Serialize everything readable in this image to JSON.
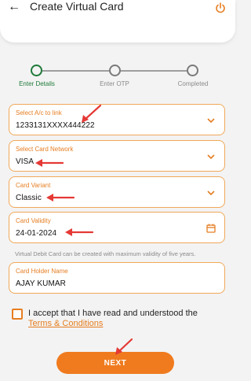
{
  "header": {
    "title": "Create Virtual Card",
    "back_icon": "arrow-left-icon",
    "power_icon": "power-icon",
    "power_color": "#e67e22"
  },
  "stepper": {
    "steps": [
      {
        "label": "Enter Details",
        "active": true
      },
      {
        "label": "Enter OTP",
        "active": false
      },
      {
        "label": "Completed",
        "active": false
      }
    ],
    "active_color": "#1f7a3a"
  },
  "form": {
    "account": {
      "label": "Select A/c to link",
      "value": "1233131XXXX444222",
      "icon": "chevron-down-icon"
    },
    "network": {
      "label": "Select Card Network",
      "value": "VISA",
      "icon": "chevron-down-icon"
    },
    "variant": {
      "label": "Card Variant",
      "value": "Classic",
      "icon": "chevron-down-icon"
    },
    "validity": {
      "label": "Card Validity",
      "value": "24-01-2024",
      "icon": "calendar-icon"
    },
    "validity_helper": "Virtual Debit Card can be created with maximum validity of five years.",
    "holder": {
      "label": "Card Holder Name",
      "value": "AJAY KUMAR"
    }
  },
  "consent": {
    "text": "I accept that I have read and understood the",
    "link": "Terms & Conditions"
  },
  "next_label": "NEXT",
  "colors": {
    "accent": "#f07b1f",
    "annotation": "#e53935"
  }
}
